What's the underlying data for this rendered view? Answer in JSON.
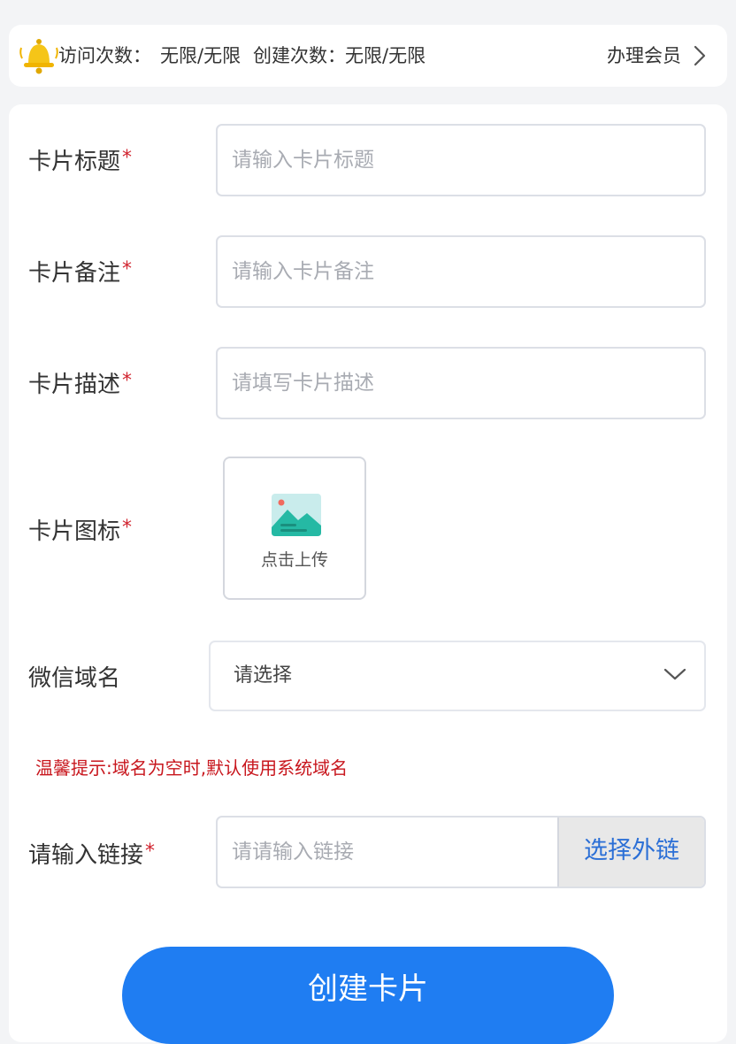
{
  "notice": {
    "visits_label": "访问次数：",
    "visits_value": "无限/无限",
    "creations_label": "创建次数：",
    "creations_value": "无限/无限",
    "member_link": "办理会员",
    "bell_color": "#f5c518"
  },
  "form": {
    "title": {
      "label": "卡片标题",
      "required": "*",
      "placeholder": "请输入卡片标题"
    },
    "remark": {
      "label": "卡片备注",
      "required": "*",
      "placeholder": "请输入卡片备注"
    },
    "description": {
      "label": "卡片描述",
      "required": "*",
      "placeholder": "请填写卡片描述"
    },
    "icon": {
      "label": "卡片图标",
      "required": "*",
      "upload_text": "点击上传"
    },
    "domain": {
      "label": "微信域名",
      "selected": "请选择"
    },
    "tip": "温馨提示:域名为空时,默认使用系统域名",
    "link": {
      "label": "请输入链接",
      "required": "*",
      "placeholder": "请请输入链接",
      "button": "选择外链"
    },
    "submit": "创建卡片"
  },
  "colors": {
    "accent": "#1f7df2",
    "required": "#d1242f",
    "tip": "#c8161d",
    "link_button_text": "#2b6fd6"
  },
  "icons": [
    "bell-icon",
    "chevron-right-icon",
    "image-upload-icon",
    "chevron-down-icon"
  ]
}
